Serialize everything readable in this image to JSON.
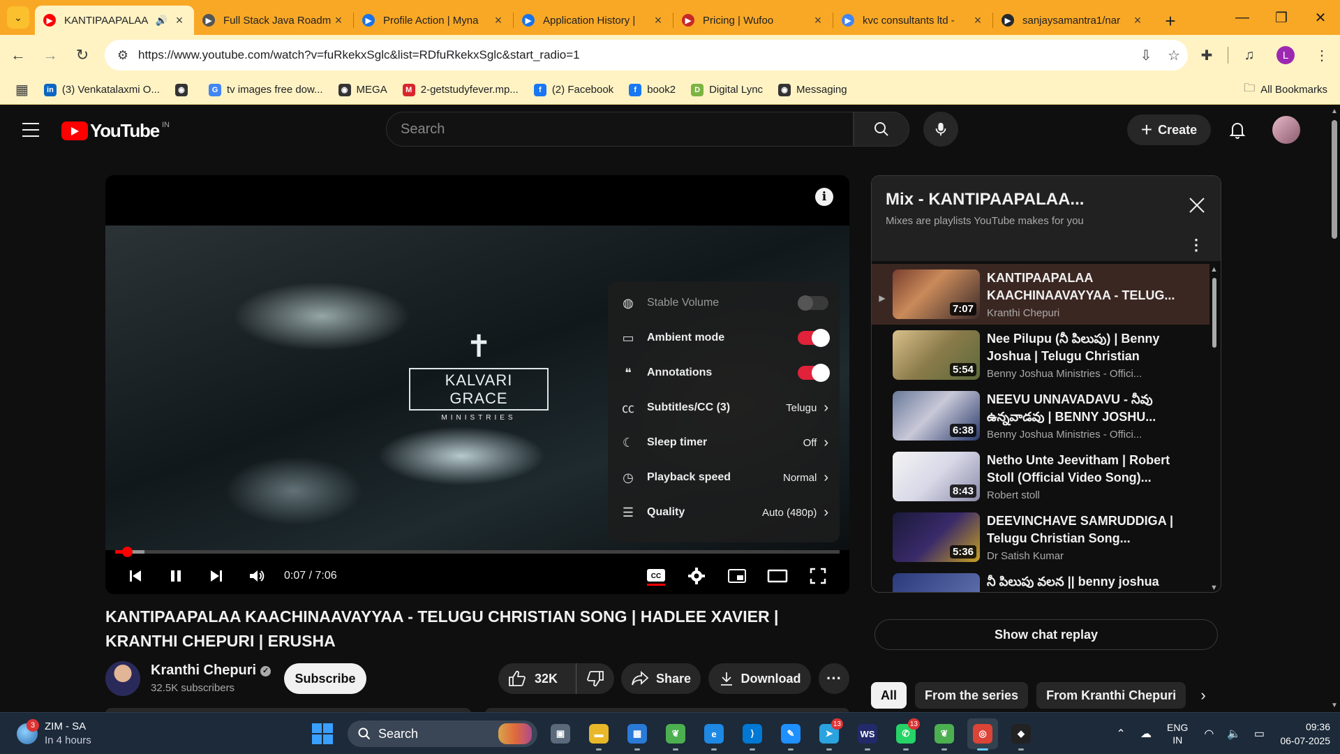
{
  "browser": {
    "tabs": [
      {
        "title": "KANTIPAAPALAA",
        "active": true,
        "favicon": "youtube-favicon",
        "color": "#ff0000",
        "audio": true
      },
      {
        "title": "Full Stack Java Roadm",
        "favicon": "roadmap-favicon",
        "color": "#555555"
      },
      {
        "title": "Profile Action | Myna",
        "favicon": "myna-favicon",
        "color": "#1a73e8"
      },
      {
        "title": "Application History |",
        "favicon": "myna-favicon",
        "color": "#1a73e8"
      },
      {
        "title": "Pricing | Wufoo",
        "favicon": "wufoo-favicon",
        "color": "#c62828"
      },
      {
        "title": "kvc consultants ltd -",
        "favicon": "google-favicon",
        "color": "#4285f4"
      },
      {
        "title": "sanjaysamantra1/nar",
        "favicon": "github-favicon",
        "color": "#24292e"
      }
    ],
    "url": "https://www.youtube.com/watch?v=fuRkekxSglc&list=RDfuRkekxSglc&start_radio=1",
    "profile_initial": "L",
    "bookmarks": [
      {
        "label": "(3) Venkatalaxmi O...",
        "icon": "linkedin-icon",
        "color": "#0a66c2",
        "glyph": "in"
      },
      {
        "label": "",
        "icon": "globe-icon",
        "color": "#333333",
        "glyph": "◉"
      },
      {
        "label": "tv images free dow...",
        "icon": "google-icon",
        "color": "#4285f4",
        "glyph": "G"
      },
      {
        "label": "MEGA",
        "icon": "globe-icon",
        "color": "#333333",
        "glyph": "◉"
      },
      {
        "label": "2-getstudyfever.mp...",
        "icon": "mega-icon",
        "color": "#d9272e",
        "glyph": "M"
      },
      {
        "label": "(2) Facebook",
        "icon": "facebook-icon",
        "color": "#1877f2",
        "glyph": "f"
      },
      {
        "label": "book2",
        "icon": "facebook-icon",
        "color": "#1877f2",
        "glyph": "f"
      },
      {
        "label": "Digital Lync",
        "icon": "digital-lync-icon",
        "color": "#7cb342",
        "glyph": "D"
      },
      {
        "label": "Messaging",
        "icon": "globe-icon",
        "color": "#333333",
        "glyph": "◉"
      }
    ],
    "all_bookmarks": "All Bookmarks"
  },
  "youtube": {
    "country": "IN",
    "search_placeholder": "Search",
    "create_label": "Create",
    "player": {
      "watermark": "KALVARI GRACE",
      "watermark_sub": "MINISTRIES",
      "time": "0:07 / 7:06",
      "progress_fraction": 0.016,
      "buffered_fraction": 0.04,
      "settings": [
        {
          "label": "Stable Volume",
          "icon": "stable-volume-icon",
          "type": "toggle",
          "on": false,
          "disabled": true
        },
        {
          "label": "Ambient mode",
          "icon": "ambient-mode-icon",
          "type": "toggle",
          "on": true
        },
        {
          "label": "Annotations",
          "icon": "annotations-icon",
          "type": "toggle",
          "on": true
        },
        {
          "label": "Subtitles/CC (3)",
          "icon": "subtitles-icon",
          "type": "submenu",
          "value": "Telugu"
        },
        {
          "label": "Sleep timer",
          "icon": "sleep-timer-icon",
          "type": "submenu",
          "value": "Off"
        },
        {
          "label": "Playback speed",
          "icon": "playback-speed-icon",
          "type": "submenu",
          "value": "Normal"
        },
        {
          "label": "Quality",
          "icon": "quality-icon",
          "type": "submenu",
          "value": "Auto (480p)"
        }
      ]
    },
    "video": {
      "title": "KANTIPAAPALAA KAACHINAAVAYYAA - TELUGU CHRISTIAN SONG | HADLEE XAVIER | KRANTHI CHEPURI | ERUSHA",
      "channel": "Kranthi Chepuri",
      "subscribers": "32.5K subscribers",
      "subscribe_label": "Subscribe",
      "likes": "32K",
      "share_label": "Share",
      "download_label": "Download"
    },
    "mix": {
      "title": "Mix - KANTIPAAPALAA...",
      "subtitle": "Mixes are playlists YouTube makes for you",
      "items": [
        {
          "title": "KANTIPAAPALAA KAACHINAAVAYYAA - TELUG...",
          "channel": "Kranthi Chepuri",
          "duration": "7:07",
          "current": true,
          "thumb": "linear-gradient(135deg,#7a3f2e,#c98a5a 40%,#3a2a2a)"
        },
        {
          "title": "Nee Pilupu (నీ పిలుపు) | Benny Joshua | Telugu Christian Son...",
          "channel": "Benny Joshua Ministries - Offici...",
          "duration": "5:54",
          "thumb": "linear-gradient(135deg,#d9c08a,#8a7a4a 50%,#5a6a3a)"
        },
        {
          "title": "NEEVU UNNAVADAVU - నీవు ఉన్నవాడవు | BENNY JOSHU...",
          "channel": "Benny Joshua Ministries - Offici...",
          "duration": "6:38",
          "thumb": "linear-gradient(135deg,#6a7a9a,#c8c8d8 45%,#2a3a6a)"
        },
        {
          "title": "Netho Unte Jeevitham | Robert Stoll (Official Video Song)...",
          "channel": "Robert stoll",
          "duration": "8:43",
          "thumb": "linear-gradient(135deg,#f4f4f4,#d8d8e8 50%,#8a8aa8)"
        },
        {
          "title": "DEEVINCHAVE SAMRUDDIGA | Telugu Christian Song...",
          "channel": "Dr Satish Kumar",
          "duration": "5:36",
          "thumb": "linear-gradient(135deg,#1a1a3a,#3a2a6a 50%,#c8a020)"
        },
        {
          "title": "నీ పిలుపు వలన || benny joshua",
          "channel": "",
          "duration": "",
          "thumb": "linear-gradient(135deg,#2a3a7a,#6a7ab8)"
        }
      ],
      "show_chat_replay": "Show chat replay",
      "chips": [
        "All",
        "From the series",
        "From Kranthi Chepuri"
      ]
    }
  },
  "taskbar": {
    "weather_title": "ZIM - SA",
    "weather_sub": "In 4 hours",
    "weather_badge": "3",
    "search_label": "Search",
    "apps": [
      {
        "name": "task-view-icon",
        "glyph": "▣",
        "color": "#5a6a7a"
      },
      {
        "name": "file-explorer-icon",
        "glyph": "▬",
        "color": "#e8b828"
      },
      {
        "name": "microsoft-store-icon",
        "glyph": "▦",
        "color": "#2a7ad8"
      },
      {
        "name": "app-leaf-icon",
        "glyph": "❦",
        "color": "#4caf50"
      },
      {
        "name": "edge-icon",
        "glyph": "e",
        "color": "#1e88e5"
      },
      {
        "name": "vscode-icon",
        "glyph": "⟩",
        "color": "#0078d4"
      },
      {
        "name": "paint-icon",
        "glyph": "✎",
        "color": "#1e90ff"
      },
      {
        "name": "telegram-icon",
        "glyph": "➤",
        "color": "#2aa3e0",
        "badge": "13"
      },
      {
        "name": "ws-icon",
        "glyph": "WS",
        "color": "#222a6a"
      },
      {
        "name": "whatsapp-icon",
        "glyph": "✆",
        "color": "#25d366",
        "badge": "13"
      },
      {
        "name": "app-leaf2-icon",
        "glyph": "❦",
        "color": "#4caf50"
      },
      {
        "name": "chrome-icon",
        "glyph": "◎",
        "color": "#db4437",
        "active": true
      },
      {
        "name": "app-dark-icon",
        "glyph": "◆",
        "color": "#222222"
      }
    ],
    "lang_top": "ENG",
    "lang_bottom": "IN",
    "time": "09:36",
    "date": "06-07-2025"
  }
}
